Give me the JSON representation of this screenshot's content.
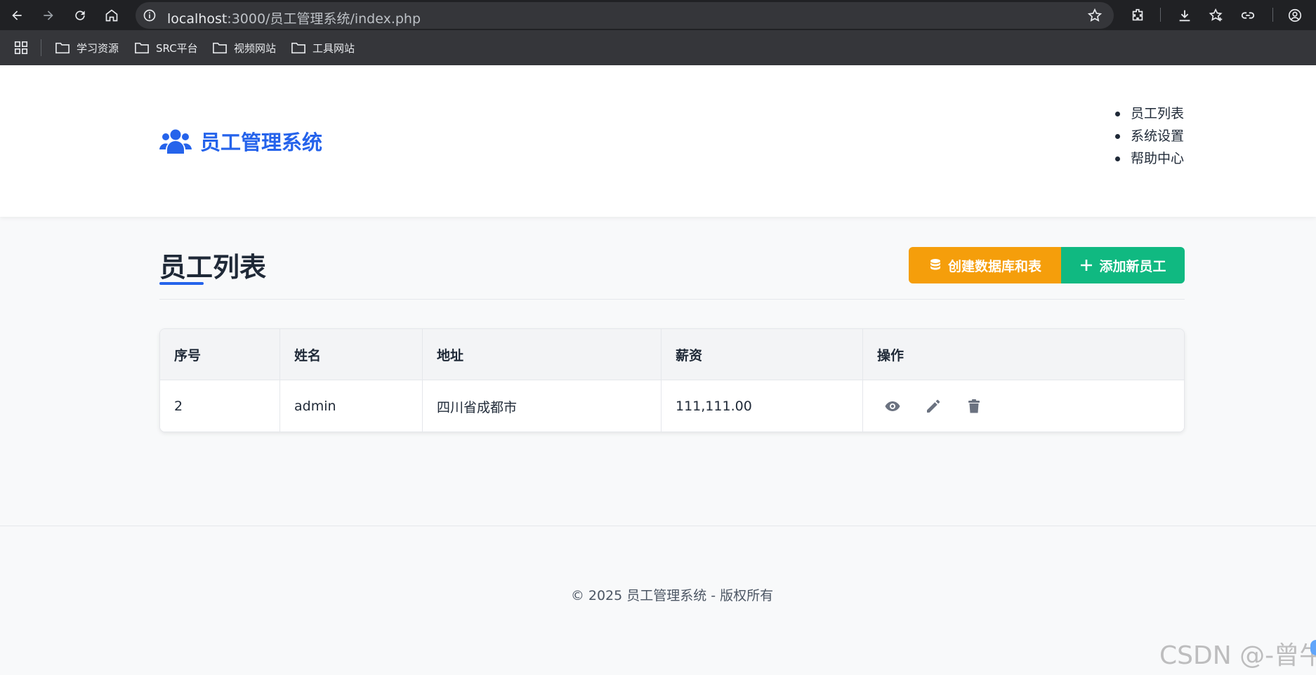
{
  "browser": {
    "url_host": "localhost",
    "url_rest": ":3000/员工管理系统/index.php",
    "bookmarks": [
      {
        "label": "学习资源"
      },
      {
        "label": "SRC平台"
      },
      {
        "label": "视频网站"
      },
      {
        "label": "工具网站"
      }
    ]
  },
  "header": {
    "logo_text": "员工管理系统",
    "nav": [
      {
        "label": "员工列表"
      },
      {
        "label": "系统设置"
      },
      {
        "label": "帮助中心"
      }
    ]
  },
  "main": {
    "title": "员工列表",
    "buttons": {
      "create_db": "创建数据库和表",
      "add_employee": "添加新员工"
    },
    "table": {
      "columns": [
        "序号",
        "姓名",
        "地址",
        "薪资",
        "操作"
      ],
      "rows": [
        {
          "id": "2",
          "name": "admin",
          "address": "四川省成都市",
          "salary": "111,111.00"
        }
      ]
    }
  },
  "footer": {
    "text": "© 2025 员工管理系统 - 版权所有"
  },
  "watermark": "CSDN @-曾牛",
  "colors": {
    "primary": "#2563eb",
    "create_button": "#f59e0b",
    "add_button": "#10b981",
    "action_icon": "#6b7280"
  }
}
